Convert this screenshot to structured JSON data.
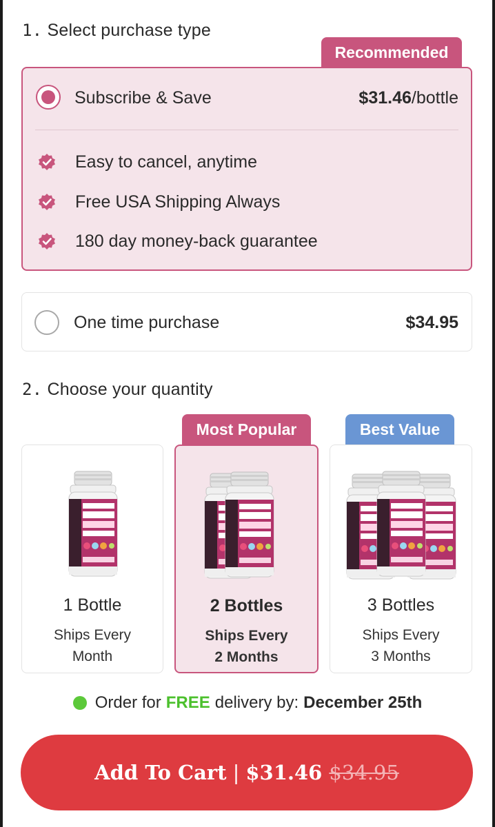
{
  "step1": {
    "number": "1.",
    "title": "Select purchase type"
  },
  "subscribe": {
    "badge": "Recommended",
    "label": "Subscribe & Save",
    "price": "$31.46",
    "unit": "/bottle",
    "benefits": [
      {
        "icon": "check-badge-icon",
        "text": "Easy to cancel, anytime"
      },
      {
        "icon": "check-badge-icon",
        "text": "Free USA Shipping Always"
      },
      {
        "icon": "check-badge-icon",
        "text": "180 day money-back guarantee"
      }
    ],
    "selected": true
  },
  "one_time": {
    "label": "One time purchase",
    "price": "$34.95",
    "selected": false
  },
  "step2": {
    "number": "2.",
    "title": "Choose your quantity"
  },
  "quantities": [
    {
      "badge": "",
      "title": "1 Bottle",
      "line1": "Ships Every",
      "line2": "Month",
      "selected": false
    },
    {
      "badge": "Most Popular",
      "title": "2 Bottles",
      "line1": "Ships Every",
      "line2": "2 Months",
      "selected": true
    },
    {
      "badge": "Best Value",
      "title": "3 Bottles",
      "line1": "Ships Every",
      "line2": "3 Months",
      "selected": false
    }
  ],
  "delivery": {
    "prefix": "Order for",
    "free": "FREE",
    "middle": "delivery by:",
    "date": "December 25th"
  },
  "cart": {
    "label": "Add To Cart",
    "separator": "|",
    "price": "$31.46",
    "old_price": "$34.95"
  },
  "colors": {
    "accent": "#c8557d",
    "accent_bg": "#f5e4ea",
    "best_value": "#6a96d4",
    "cta": "#de3b40",
    "free_green": "#4cc02d"
  }
}
